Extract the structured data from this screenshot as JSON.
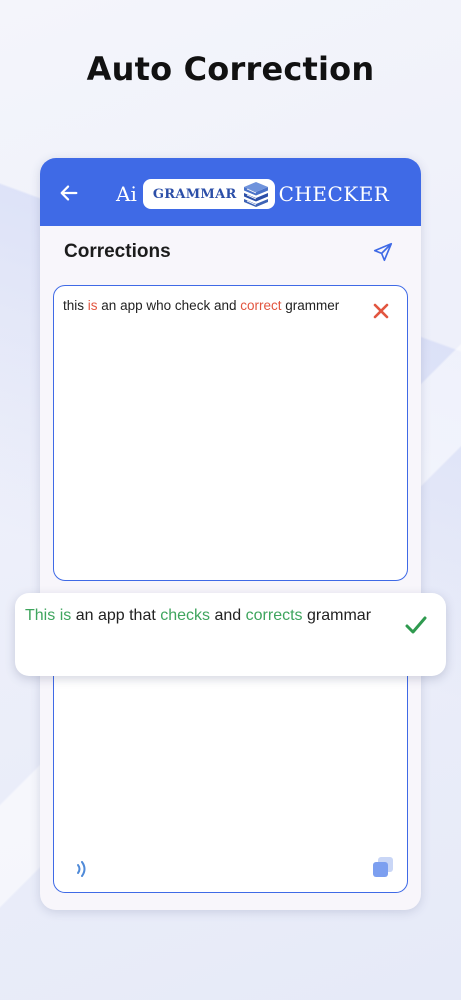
{
  "headline": "Auto Correction",
  "appbar": {
    "logo_ai": "Ai",
    "logo_grammar": "GRAMMAR",
    "logo_checker": "CHECKER"
  },
  "section_title": "Corrections",
  "input": {
    "segments": [
      {
        "text": "this",
        "kind": "normal"
      },
      {
        "text": "is",
        "kind": "error"
      },
      {
        "text": "an",
        "kind": "normal"
      },
      {
        "text": "app",
        "kind": "normal"
      },
      {
        "text": "who",
        "kind": "normal"
      },
      {
        "text": "check",
        "kind": "normal"
      },
      {
        "text": "and",
        "kind": "normal"
      },
      {
        "text": "correct",
        "kind": "error"
      },
      {
        "text": "grammer",
        "kind": "normal"
      }
    ]
  },
  "result": {
    "segments": [
      {
        "text": "This",
        "kind": "fixed"
      },
      {
        "text": "is",
        "kind": "fixed"
      },
      {
        "text": "an",
        "kind": "normal"
      },
      {
        "text": "app",
        "kind": "normal"
      },
      {
        "text": "that",
        "kind": "normal"
      },
      {
        "text": "checks",
        "kind": "fixed"
      },
      {
        "text": "and",
        "kind": "normal"
      },
      {
        "text": "corrects",
        "kind": "fixed"
      },
      {
        "text": "grammar",
        "kind": "normal"
      }
    ]
  },
  "colors": {
    "accent": "#3f6ae6",
    "error": "#e2553f",
    "fixed": "#3fa55e"
  },
  "icons": {
    "back": "arrow-left-icon",
    "send": "send-icon",
    "clear": "close-icon",
    "accept": "check-icon",
    "voice": "speaker-icon",
    "copy": "copy-icon",
    "logo": "book-stack-icon"
  }
}
